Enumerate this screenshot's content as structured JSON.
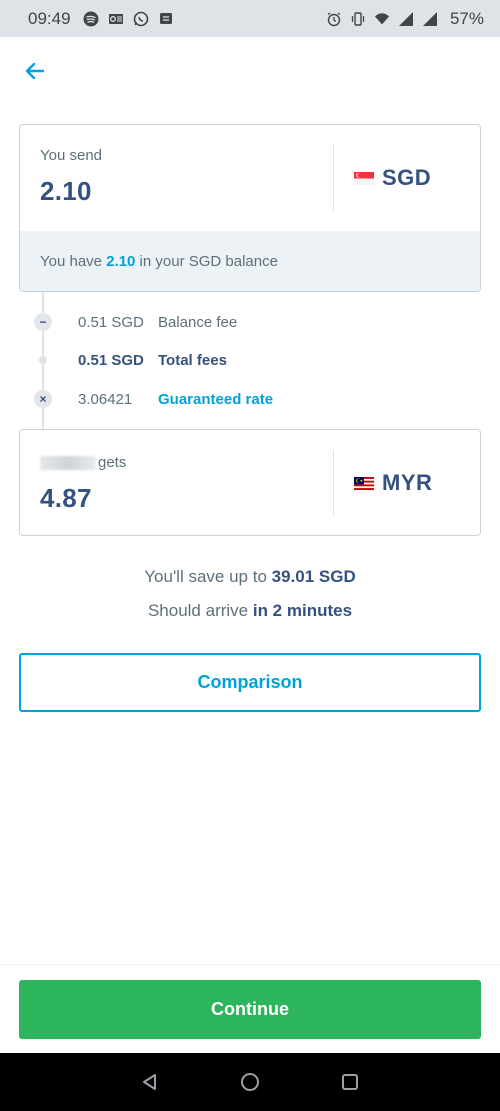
{
  "status_bar": {
    "time": "09:49",
    "battery": "57%"
  },
  "send": {
    "label": "You send",
    "amount": "2.10",
    "currency": "SGD",
    "balance_prefix": "You have ",
    "balance_amount": "2.10",
    "balance_suffix": " in your SGD balance"
  },
  "fees": [
    {
      "amount": "0.51 SGD",
      "label": "Balance fee",
      "marker": "−"
    },
    {
      "amount": "0.51 SGD",
      "label": "Total fees",
      "marker": ""
    },
    {
      "amount": "3.06421",
      "label": "Guaranteed rate",
      "marker": "×"
    }
  ],
  "receive": {
    "label_suffix": "gets",
    "amount": "4.87",
    "currency": "MYR"
  },
  "summary": {
    "save_prefix": "You'll save up to ",
    "save_amount": "39.01 SGD",
    "arrive_prefix": "Should arrive ",
    "arrive_time": "in 2 minutes"
  },
  "buttons": {
    "comparison": "Comparison",
    "continue": "Continue"
  },
  "colors": {
    "accent": "#00a2dd",
    "primary": "#2db55d",
    "text_dark": "#37517e"
  }
}
